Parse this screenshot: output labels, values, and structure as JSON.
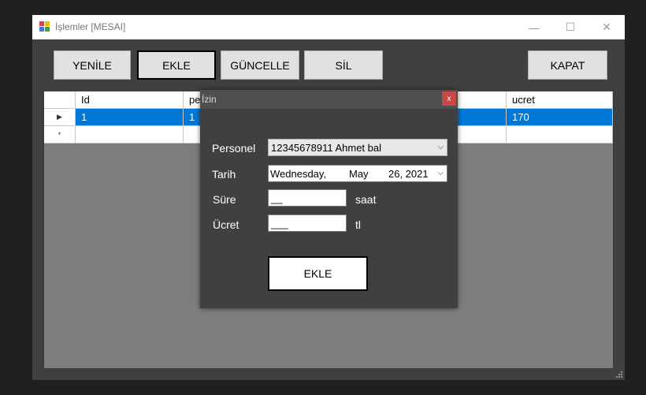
{
  "window": {
    "title": "İşlemler [MESAI]",
    "minimize": "—",
    "maximize": "☐",
    "close": "✕"
  },
  "toolbar": {
    "refresh_label": "YENİLE",
    "add_label": "EKLE",
    "update_label": "GÜNCELLE",
    "delete_label": "SİL",
    "close_label": "KAPAT"
  },
  "grid": {
    "columns": [
      "Id",
      "pe",
      "ucret"
    ],
    "rows": [
      {
        "id": "1",
        "personel": "1",
        "ucret": "170"
      }
    ],
    "current_row_marker": "▶",
    "new_row_marker": "*"
  },
  "dialog": {
    "title": "İzin",
    "close": "x",
    "personel_label": "Personel",
    "personel_value": "12345678911 Ahmet bal",
    "tarih_label": "Tarih",
    "date_weekday": "Wednesday,",
    "date_month": "May",
    "date_day_year": "26, 2021",
    "sure_label": "Süre",
    "sure_value": "__",
    "sure_unit": "saat",
    "ucret_label": "Ücret",
    "ucret_value": "___",
    "ucret_unit": "tl",
    "submit_label": "EKLE"
  }
}
